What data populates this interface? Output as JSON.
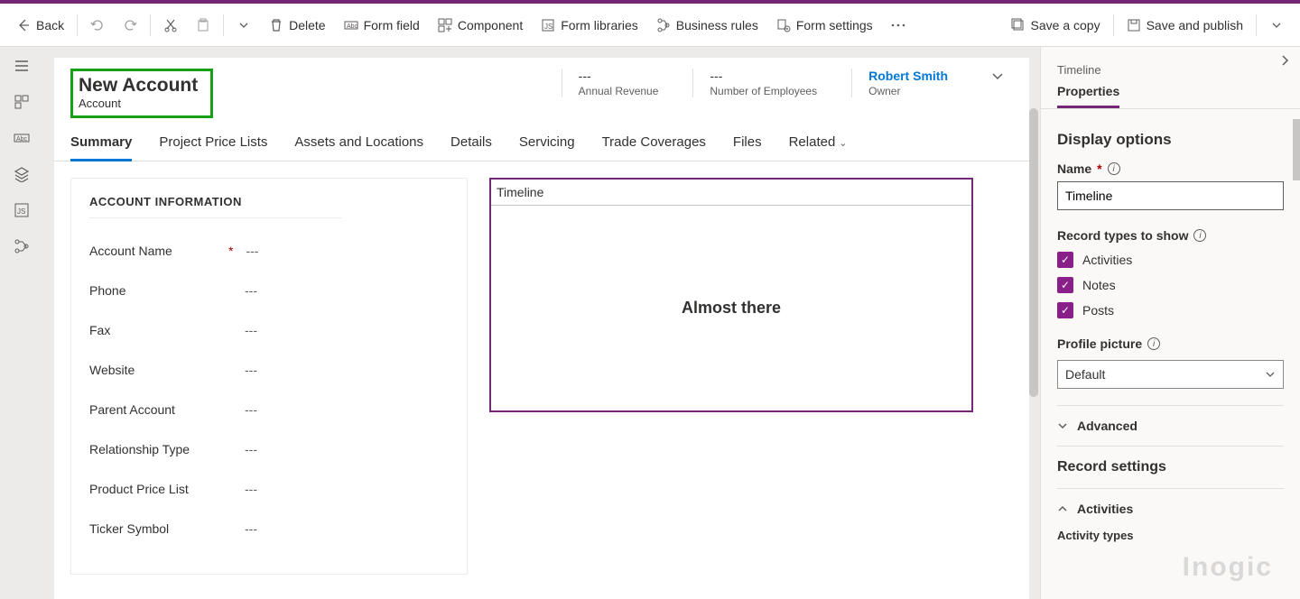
{
  "toolbar": {
    "back": "Back",
    "delete": "Delete",
    "formField": "Form field",
    "component": "Component",
    "formLibraries": "Form libraries",
    "businessRules": "Business rules",
    "formSettings": "Form settings",
    "saveCopy": "Save a copy",
    "savePublish": "Save and publish"
  },
  "header": {
    "title": "New Account",
    "subtitle": "Account",
    "fields": [
      {
        "value": "---",
        "label": "Annual Revenue"
      },
      {
        "value": "---",
        "label": "Number of Employees"
      }
    ],
    "owner": {
      "value": "Robert Smith",
      "label": "Owner"
    }
  },
  "tabs": [
    "Summary",
    "Project Price Lists",
    "Assets and Locations",
    "Details",
    "Servicing",
    "Trade Coverages",
    "Files",
    "Related"
  ],
  "accountSection": {
    "title": "ACCOUNT INFORMATION",
    "fields": [
      {
        "label": "Account Name",
        "value": "---",
        "required": true
      },
      {
        "label": "Phone",
        "value": "---"
      },
      {
        "label": "Fax",
        "value": "---"
      },
      {
        "label": "Website",
        "value": "---"
      },
      {
        "label": "Parent Account",
        "value": "---"
      },
      {
        "label": "Relationship Type",
        "value": "---"
      },
      {
        "label": "Product Price List",
        "value": "---"
      },
      {
        "label": "Ticker Symbol",
        "value": "---"
      }
    ]
  },
  "timeline": {
    "title": "Timeline",
    "body": "Almost there"
  },
  "panel": {
    "breadcrumb": "Timeline",
    "tab": "Properties",
    "displayOptions": "Display options",
    "nameLabel": "Name",
    "nameValue": "Timeline",
    "recordTypes": "Record types to show",
    "checks": [
      "Activities",
      "Notes",
      "Posts"
    ],
    "profilePicture": "Profile picture",
    "profileValue": "Default",
    "advanced": "Advanced",
    "recordSettings": "Record settings",
    "activities": "Activities",
    "activityTypes": "Activity types"
  },
  "watermark": "Inogic"
}
